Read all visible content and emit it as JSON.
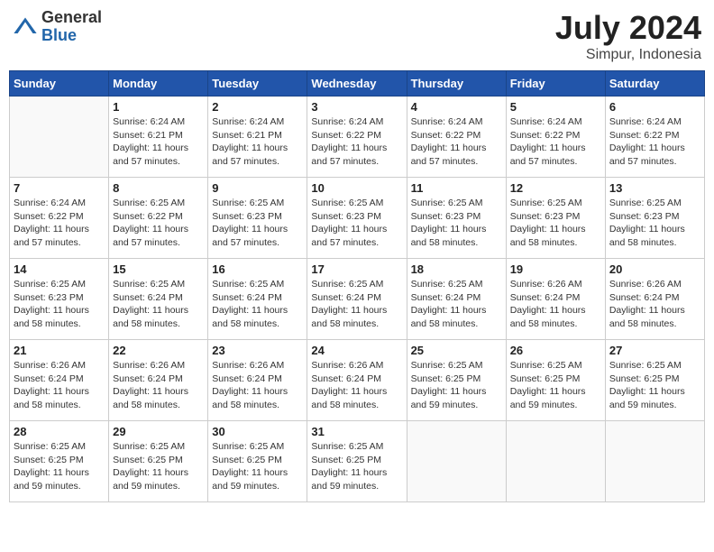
{
  "header": {
    "logo_general": "General",
    "logo_blue": "Blue",
    "title": "July 2024",
    "subtitle": "Simpur, Indonesia"
  },
  "weekdays": [
    "Sunday",
    "Monday",
    "Tuesday",
    "Wednesday",
    "Thursday",
    "Friday",
    "Saturday"
  ],
  "weeks": [
    [
      {
        "day": "",
        "sunrise": "",
        "sunset": "",
        "daylight": ""
      },
      {
        "day": "1",
        "sunrise": "6:24 AM",
        "sunset": "6:21 PM",
        "daylight": "11 hours and 57 minutes."
      },
      {
        "day": "2",
        "sunrise": "6:24 AM",
        "sunset": "6:21 PM",
        "daylight": "11 hours and 57 minutes."
      },
      {
        "day": "3",
        "sunrise": "6:24 AM",
        "sunset": "6:22 PM",
        "daylight": "11 hours and 57 minutes."
      },
      {
        "day": "4",
        "sunrise": "6:24 AM",
        "sunset": "6:22 PM",
        "daylight": "11 hours and 57 minutes."
      },
      {
        "day": "5",
        "sunrise": "6:24 AM",
        "sunset": "6:22 PM",
        "daylight": "11 hours and 57 minutes."
      },
      {
        "day": "6",
        "sunrise": "6:24 AM",
        "sunset": "6:22 PM",
        "daylight": "11 hours and 57 minutes."
      }
    ],
    [
      {
        "day": "7",
        "sunrise": "6:24 AM",
        "sunset": "6:22 PM",
        "daylight": "11 hours and 57 minutes."
      },
      {
        "day": "8",
        "sunrise": "6:25 AM",
        "sunset": "6:22 PM",
        "daylight": "11 hours and 57 minutes."
      },
      {
        "day": "9",
        "sunrise": "6:25 AM",
        "sunset": "6:23 PM",
        "daylight": "11 hours and 57 minutes."
      },
      {
        "day": "10",
        "sunrise": "6:25 AM",
        "sunset": "6:23 PM",
        "daylight": "11 hours and 57 minutes."
      },
      {
        "day": "11",
        "sunrise": "6:25 AM",
        "sunset": "6:23 PM",
        "daylight": "11 hours and 58 minutes."
      },
      {
        "day": "12",
        "sunrise": "6:25 AM",
        "sunset": "6:23 PM",
        "daylight": "11 hours and 58 minutes."
      },
      {
        "day": "13",
        "sunrise": "6:25 AM",
        "sunset": "6:23 PM",
        "daylight": "11 hours and 58 minutes."
      }
    ],
    [
      {
        "day": "14",
        "sunrise": "6:25 AM",
        "sunset": "6:23 PM",
        "daylight": "11 hours and 58 minutes."
      },
      {
        "day": "15",
        "sunrise": "6:25 AM",
        "sunset": "6:24 PM",
        "daylight": "11 hours and 58 minutes."
      },
      {
        "day": "16",
        "sunrise": "6:25 AM",
        "sunset": "6:24 PM",
        "daylight": "11 hours and 58 minutes."
      },
      {
        "day": "17",
        "sunrise": "6:25 AM",
        "sunset": "6:24 PM",
        "daylight": "11 hours and 58 minutes."
      },
      {
        "day": "18",
        "sunrise": "6:25 AM",
        "sunset": "6:24 PM",
        "daylight": "11 hours and 58 minutes."
      },
      {
        "day": "19",
        "sunrise": "6:26 AM",
        "sunset": "6:24 PM",
        "daylight": "11 hours and 58 minutes."
      },
      {
        "day": "20",
        "sunrise": "6:26 AM",
        "sunset": "6:24 PM",
        "daylight": "11 hours and 58 minutes."
      }
    ],
    [
      {
        "day": "21",
        "sunrise": "6:26 AM",
        "sunset": "6:24 PM",
        "daylight": "11 hours and 58 minutes."
      },
      {
        "day": "22",
        "sunrise": "6:26 AM",
        "sunset": "6:24 PM",
        "daylight": "11 hours and 58 minutes."
      },
      {
        "day": "23",
        "sunrise": "6:26 AM",
        "sunset": "6:24 PM",
        "daylight": "11 hours and 58 minutes."
      },
      {
        "day": "24",
        "sunrise": "6:26 AM",
        "sunset": "6:24 PM",
        "daylight": "11 hours and 58 minutes."
      },
      {
        "day": "25",
        "sunrise": "6:25 AM",
        "sunset": "6:25 PM",
        "daylight": "11 hours and 59 minutes."
      },
      {
        "day": "26",
        "sunrise": "6:25 AM",
        "sunset": "6:25 PM",
        "daylight": "11 hours and 59 minutes."
      },
      {
        "day": "27",
        "sunrise": "6:25 AM",
        "sunset": "6:25 PM",
        "daylight": "11 hours and 59 minutes."
      }
    ],
    [
      {
        "day": "28",
        "sunrise": "6:25 AM",
        "sunset": "6:25 PM",
        "daylight": "11 hours and 59 minutes."
      },
      {
        "day": "29",
        "sunrise": "6:25 AM",
        "sunset": "6:25 PM",
        "daylight": "11 hours and 59 minutes."
      },
      {
        "day": "30",
        "sunrise": "6:25 AM",
        "sunset": "6:25 PM",
        "daylight": "11 hours and 59 minutes."
      },
      {
        "day": "31",
        "sunrise": "6:25 AM",
        "sunset": "6:25 PM",
        "daylight": "11 hours and 59 minutes."
      },
      {
        "day": "",
        "sunrise": "",
        "sunset": "",
        "daylight": ""
      },
      {
        "day": "",
        "sunrise": "",
        "sunset": "",
        "daylight": ""
      },
      {
        "day": "",
        "sunrise": "",
        "sunset": "",
        "daylight": ""
      }
    ]
  ]
}
